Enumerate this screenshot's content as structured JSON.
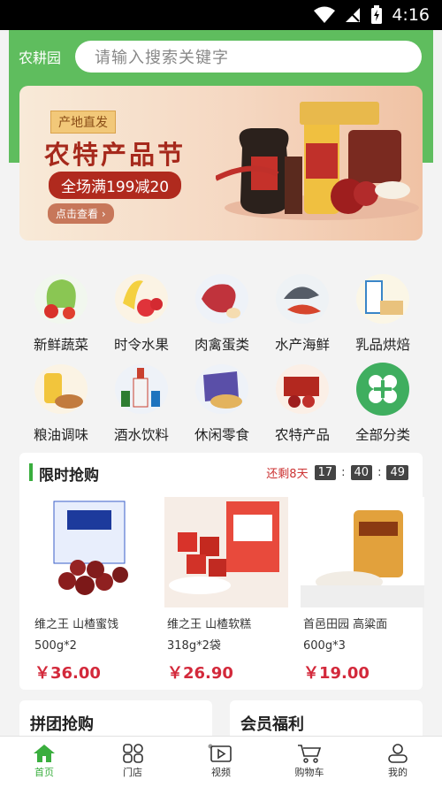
{
  "status": {
    "time": "4:16"
  },
  "header": {
    "store_name": "农耕园",
    "search_placeholder": "请输入搜索关键字"
  },
  "banner": {
    "tag": "产地直发",
    "headline": "农特产品节",
    "promo": "全场满199减20",
    "cta": "点击查看 ›"
  },
  "categories": [
    {
      "label": "新鲜蔬菜"
    },
    {
      "label": "时令水果"
    },
    {
      "label": "肉禽蛋类"
    },
    {
      "label": "水产海鲜"
    },
    {
      "label": "乳品烘焙"
    },
    {
      "label": "粮油调味"
    },
    {
      "label": "酒水饮料"
    },
    {
      "label": "休闲零食"
    },
    {
      "label": "农特产品"
    },
    {
      "label": "全部分类"
    }
  ],
  "flash_sale": {
    "title": "限时抢购",
    "remain_label": "还剩8天",
    "hours": "17",
    "minutes": "40",
    "seconds": "49",
    "products": [
      {
        "name_line1": "维之王 山楂蜜饯",
        "name_line2": "500g*2",
        "price": "￥36.00"
      },
      {
        "name_line1": "维之王 山楂软糕",
        "name_line2": "318g*2袋",
        "price": "￥26.90"
      },
      {
        "name_line1": "首邑田园 高粱面",
        "name_line2": "600g*3",
        "price": "￥19.00"
      }
    ]
  },
  "sections": {
    "group_buy": "拼团抢购",
    "member": "会员福利"
  },
  "tabbar": [
    {
      "label": "首页"
    },
    {
      "label": "门店"
    },
    {
      "label": "视频"
    },
    {
      "label": "购物车"
    },
    {
      "label": "我的"
    }
  ],
  "colors": {
    "brand_green": "#5fbd5e",
    "price_red": "#d3293b",
    "active_tab": "#3aae3e"
  }
}
